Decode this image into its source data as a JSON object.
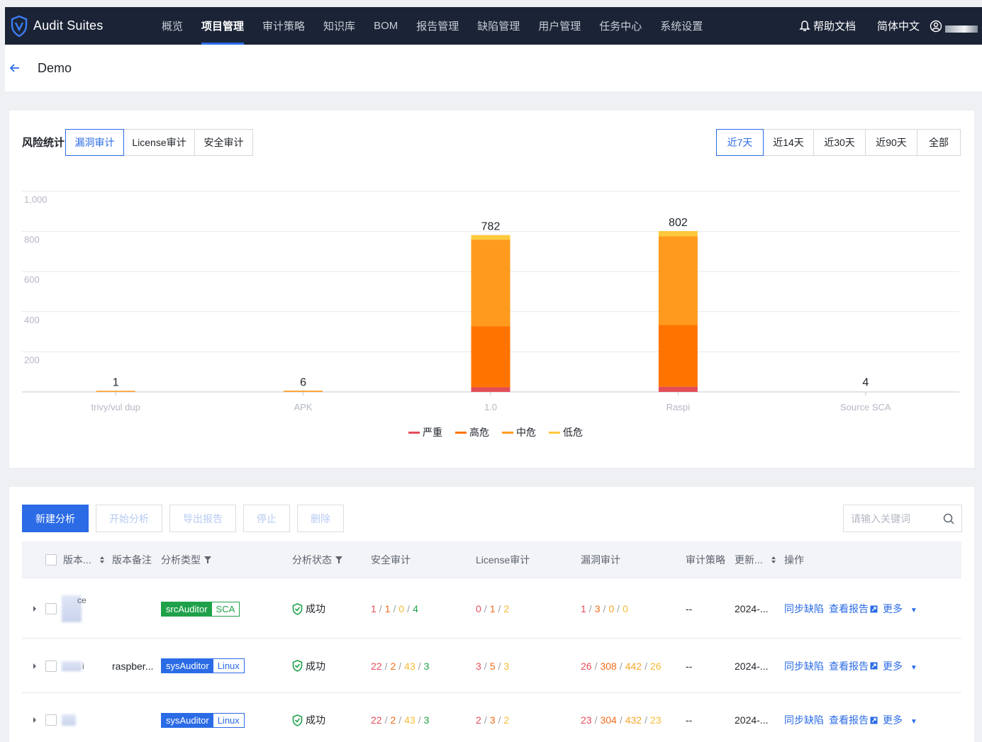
{
  "nav": {
    "brand": "Audit Suites",
    "items": [
      "概览",
      "项目管理",
      "审计策略",
      "知识库",
      "BOM",
      "报告管理",
      "缺陷管理",
      "用户管理",
      "任务中心",
      "系统设置"
    ],
    "active_index": 1,
    "help": "帮助文档",
    "lang": "简体中文"
  },
  "page": {
    "title": "Demo"
  },
  "stats": {
    "title": "风险统计",
    "audit_tabs": [
      "漏洞审计",
      "License审计",
      "安全审计"
    ],
    "active_audit_tab": 0,
    "range_tabs": [
      "近7天",
      "近14天",
      "近30天",
      "近90天",
      "全部"
    ],
    "active_range_tab": 0
  },
  "chart_data": {
    "type": "bar",
    "stacked": true,
    "categories": [
      "trivy/vul dup",
      "APK",
      "1.0",
      "Raspi",
      "Source SCA"
    ],
    "totals": [
      1,
      6,
      782,
      802,
      4
    ],
    "ylim": [
      0,
      1000
    ],
    "yticks": [
      "1,000",
      "800",
      "600",
      "400",
      "200"
    ],
    "series": [
      {
        "name": "严重",
        "values": [
          0,
          0,
          23,
          26
        ],
        "color": "#e34d59"
      },
      {
        "name": "高危",
        "values": [
          0,
          0,
          304,
          308
        ],
        "color": "#ff7400"
      },
      {
        "name": "中危",
        "values": [
          1,
          6,
          432,
          442
        ],
        "color": "#ff9a1f"
      },
      {
        "name": "低危",
        "values": [
          0,
          0,
          23,
          26
        ],
        "color": "#ffc93c"
      }
    ],
    "legend_position": "bottom",
    "grid": true
  },
  "toolbar": {
    "new": "新建分析",
    "start": "开始分析",
    "export": "导出报告",
    "stop": "停止",
    "delete": "删除",
    "search_placeholder": "请输入关键词"
  },
  "table": {
    "headers": [
      "版本...",
      "版本备注",
      "分析类型",
      "分析状态",
      "安全审计",
      "License审计",
      "漏洞审计",
      "审计策略",
      "更新...",
      "操作"
    ],
    "rows": [
      {
        "name": "ce",
        "note": "",
        "type1": "srcAuditor",
        "type2": "SCA",
        "type_kind": "src",
        "status": "成功",
        "sec": [
          "1",
          "1",
          "0",
          "4"
        ],
        "lic": [
          "0",
          "1",
          "2"
        ],
        "vul": [
          "1",
          "3",
          "0",
          "0"
        ],
        "policy": "--",
        "updated": "2024-...",
        "ops": [
          "同步缺陷",
          "查看报告",
          "更多"
        ]
      },
      {
        "name": "i",
        "note": "raspber...",
        "type1": "sysAuditor",
        "type2": "Linux",
        "type_kind": "sys",
        "status": "成功",
        "sec": [
          "22",
          "2",
          "43",
          "3"
        ],
        "lic": [
          "3",
          "5",
          "3"
        ],
        "vul": [
          "26",
          "308",
          "442",
          "26"
        ],
        "policy": "--",
        "updated": "2024-...",
        "ops": [
          "同步缺陷",
          "查看报告",
          "更多"
        ]
      },
      {
        "name": "",
        "note": "",
        "type1": "sysAuditor",
        "type2": "Linux",
        "type_kind": "sys",
        "status": "成功",
        "sec": [
          "22",
          "2",
          "43",
          "3"
        ],
        "lic": [
          "2",
          "3",
          "2"
        ],
        "vul": [
          "23",
          "304",
          "432",
          "23"
        ],
        "policy": "--",
        "updated": "2024-...",
        "ops": [
          "同步缺陷",
          "查看报告",
          "更多"
        ]
      }
    ]
  }
}
